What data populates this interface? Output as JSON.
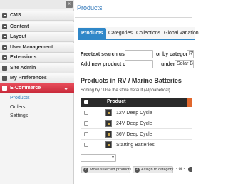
{
  "sidebar": {
    "collapse_icon": "«",
    "items": [
      {
        "label": "CMS",
        "icon": "square-icon"
      },
      {
        "label": "Content",
        "icon": "square-icon"
      },
      {
        "label": "Layout",
        "icon": "square-icon"
      },
      {
        "label": "User Management",
        "icon": "square-icon"
      },
      {
        "label": "Extensions",
        "icon": "square-icon"
      },
      {
        "label": "Site Admin",
        "icon": "square-icon"
      },
      {
        "label": "My Preferences",
        "icon": "square-icon"
      },
      {
        "label": "E-Commerce",
        "icon": "square-icon",
        "active": true
      }
    ],
    "sub_items": [
      {
        "label": "Products",
        "current": true
      },
      {
        "label": "Orders"
      },
      {
        "label": "Settings"
      }
    ],
    "active_color": "#d63a48",
    "link_color": "#2f7fbf"
  },
  "header": {
    "title": "Products"
  },
  "tabs": [
    {
      "label": "Products",
      "active": true
    },
    {
      "label": "Categories"
    },
    {
      "label": "Collections"
    },
    {
      "label": "Global variation"
    }
  ],
  "search": {
    "freetext_label": "Freetext search using",
    "freetext_value": "",
    "category_label": "or by category",
    "category_value": "RV",
    "add_label": "Add new product called",
    "add_value": "",
    "under_label": "under",
    "under_value": "Solar Ba"
  },
  "listing": {
    "title": "Products in RV / Marine Batteries",
    "sort_text": "Sorting by : Use the store default (Alphabetical)",
    "column_product": "Product",
    "rows": [
      {
        "name": "12V Deep Cycle"
      },
      {
        "name": "24V Deep Cycle"
      },
      {
        "name": "36V Deep Cycle"
      },
      {
        "name": "Starting Batteries"
      }
    ]
  },
  "actions": {
    "bulk_select_value": "",
    "move_label": "Move selected products",
    "assign_label": "Assign to category",
    "or_text": "- or -"
  },
  "colors": {
    "accent_blue": "#2f87c8",
    "header_bar_orange": "#e0672d"
  }
}
